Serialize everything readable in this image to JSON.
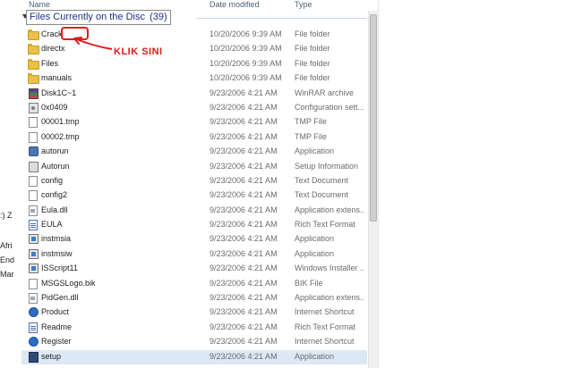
{
  "left_fragments": [
    ":) Z",
    "Afri",
    "End",
    "Mar"
  ],
  "columns": {
    "name": "Name",
    "date": "Date modified",
    "type": "Type"
  },
  "group": {
    "label": "Files Currently on the Disc",
    "count": "(39)"
  },
  "annotation": {
    "text": "KLIK SINI",
    "color": "#e01b1b"
  },
  "files": [
    {
      "name": "Crack",
      "date": "10/20/2006 9:39 AM",
      "type": "File folder",
      "icon": "folder-icon"
    },
    {
      "name": "directx",
      "date": "10/20/2006 9:39 AM",
      "type": "File folder",
      "icon": "folder-icon"
    },
    {
      "name": "Files",
      "date": "10/20/2006 9:39 AM",
      "type": "File folder",
      "icon": "folder-icon"
    },
    {
      "name": "manuals",
      "date": "10/20/2006 9:39 AM",
      "type": "File folder",
      "icon": "folder-icon"
    },
    {
      "name": "Disk1C~1",
      "date": "9/23/2006 4:21 AM",
      "type": "WinRAR archive",
      "icon": "winrar-icon"
    },
    {
      "name": "0x0409",
      "date": "9/23/2006 4:21 AM",
      "type": "Configuration sett...",
      "icon": "config-icon"
    },
    {
      "name": "00001.tmp",
      "date": "9/23/2006 4:21 AM",
      "type": "TMP File",
      "icon": "file-icon"
    },
    {
      "name": "00002.tmp",
      "date": "9/23/2006 4:21 AM",
      "type": "TMP File",
      "icon": "file-icon"
    },
    {
      "name": "autorun",
      "date": "9/23/2006 4:21 AM",
      "type": "Application",
      "icon": "app-icon"
    },
    {
      "name": "Autorun",
      "date": "9/23/2006 4:21 AM",
      "type": "Setup Information",
      "icon": "setup-info-icon"
    },
    {
      "name": "config",
      "date": "9/23/2006 4:21 AM",
      "type": "Text Document",
      "icon": "file-icon"
    },
    {
      "name": "config2",
      "date": "9/23/2006 4:21 AM",
      "type": "Text Document",
      "icon": "file-icon"
    },
    {
      "name": "Eula.dll",
      "date": "9/23/2006 4:21 AM",
      "type": "Application extens...",
      "icon": "dll-icon"
    },
    {
      "name": "EULA",
      "date": "9/23/2006 4:21 AM",
      "type": "Rich Text Format",
      "icon": "rtf-icon"
    },
    {
      "name": "instmsia",
      "date": "9/23/2006 4:21 AM",
      "type": "Application",
      "icon": "installer-icon"
    },
    {
      "name": "instmsiw",
      "date": "9/23/2006 4:21 AM",
      "type": "Application",
      "icon": "installer-icon"
    },
    {
      "name": "ISScript11",
      "date": "9/23/2006 4:21 AM",
      "type": "Windows Installer ...",
      "icon": "installer-icon"
    },
    {
      "name": "MSGSLogo.bik",
      "date": "9/23/2006 4:21 AM",
      "type": "BIK File",
      "icon": "file-icon"
    },
    {
      "name": "PidGen.dll",
      "date": "9/23/2006 4:21 AM",
      "type": "Application extens...",
      "icon": "dll-icon"
    },
    {
      "name": "Product",
      "date": "9/23/2006 4:21 AM",
      "type": "Internet Shortcut",
      "icon": "web-shortcut-icon"
    },
    {
      "name": "Readme",
      "date": "9/23/2006 4:21 AM",
      "type": "Rich Text Format",
      "icon": "rtf-icon"
    },
    {
      "name": "Register",
      "date": "9/23/2006 4:21 AM",
      "type": "Internet Shortcut",
      "icon": "web-shortcut-icon"
    },
    {
      "name": "setup",
      "date": "9/23/2006 4:21 AM",
      "type": "Application",
      "icon": "setup-icon"
    }
  ]
}
